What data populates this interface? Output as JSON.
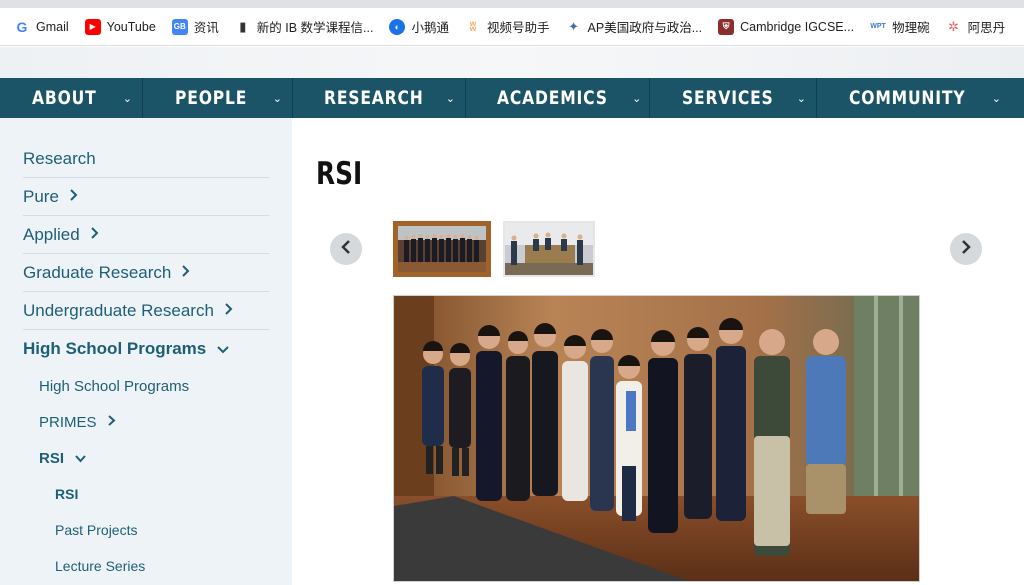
{
  "bookmarks": [
    {
      "label": "Gmail",
      "icon": "gmail-icon",
      "color": "#ea4335"
    },
    {
      "label": "YouTube",
      "icon": "youtube-icon",
      "color": "#ff0000"
    },
    {
      "label": "资讯",
      "icon": "news-icon",
      "color": "#4285f4"
    },
    {
      "label": "新的 IB 数学课程信...",
      "icon": "bookmark-icon",
      "color": "#333333"
    },
    {
      "label": "小鹅通",
      "icon": "xiaoetong-icon",
      "color": "#1a73e8"
    },
    {
      "label": "视频号助手",
      "icon": "butterfly-icon",
      "color": "#f6b26b"
    },
    {
      "label": "AP美国政府与政治...",
      "icon": "puzzle-icon",
      "color": "#4a6fa5"
    },
    {
      "label": "Cambridge IGCSE...",
      "icon": "cambridge-shield-icon",
      "color": "#8b2e2e"
    },
    {
      "label": "物理碗",
      "icon": "wpt-icon",
      "color": "#3c78d8"
    },
    {
      "label": "阿思丹",
      "icon": "pinwheel-icon",
      "color": "#e06666"
    }
  ],
  "nav": {
    "items": [
      {
        "label": "ABOUT"
      },
      {
        "label": "PEOPLE"
      },
      {
        "label": "RESEARCH"
      },
      {
        "label": "ACADEMICS"
      },
      {
        "label": "SERVICES"
      },
      {
        "label": "COMMUNITY"
      }
    ],
    "chevron": "⌄"
  },
  "sidebar": {
    "research": "Research",
    "pure": "Pure",
    "applied": "Applied",
    "graduate": "Graduate Research",
    "undergraduate": "Undergraduate Research",
    "high_school": "High School Programs",
    "hs_programs": "High School Programs",
    "primes": "PRIMES",
    "rsi": "RSI",
    "rsi_current": "RSI",
    "past_projects": "Past Projects",
    "lecture_series": "Lecture Series",
    "arrow_right": "›",
    "arrow_down": "⌄"
  },
  "content": {
    "title": "RSI",
    "prev": "‹",
    "next": "›"
  },
  "colors": {
    "nav_bg": "#1a5466",
    "sidebar_bg": "#eef3f7",
    "link": "#1e5f78",
    "thumb_border": "#a0642b"
  }
}
